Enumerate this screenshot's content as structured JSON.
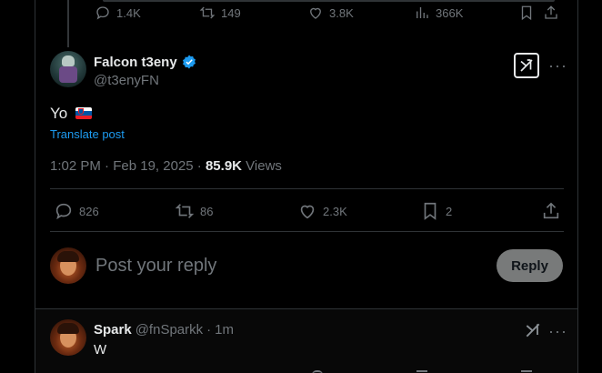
{
  "prev_tweet": {
    "replies": "1.4K",
    "reposts": "149",
    "likes": "3.8K",
    "views": "366K"
  },
  "main_tweet": {
    "display_name": "Falcon t3eny",
    "handle": "@t3enyFN",
    "text": "Yo",
    "translate": "Translate post",
    "time": "1:02 PM",
    "date": "Feb 19, 2025",
    "views_count": "85.9K",
    "views_label": "Views",
    "replies": "826",
    "reposts": "86",
    "likes": "2.3K",
    "bookmarks": "2",
    "grok_icon": "grok-icon",
    "flag_colors": [
      "#ffffff",
      "#0055a4",
      "#ed1c24"
    ]
  },
  "compose": {
    "placeholder": "Post your reply",
    "reply_label": "Reply"
  },
  "reply_tweet": {
    "display_name": "Spark",
    "handle": "@fnSparkk",
    "separator": "·",
    "time": "1m",
    "text": "W"
  },
  "colors": {
    "accent": "#1d9bf0",
    "muted": "#71767b",
    "border": "#2f3336"
  }
}
